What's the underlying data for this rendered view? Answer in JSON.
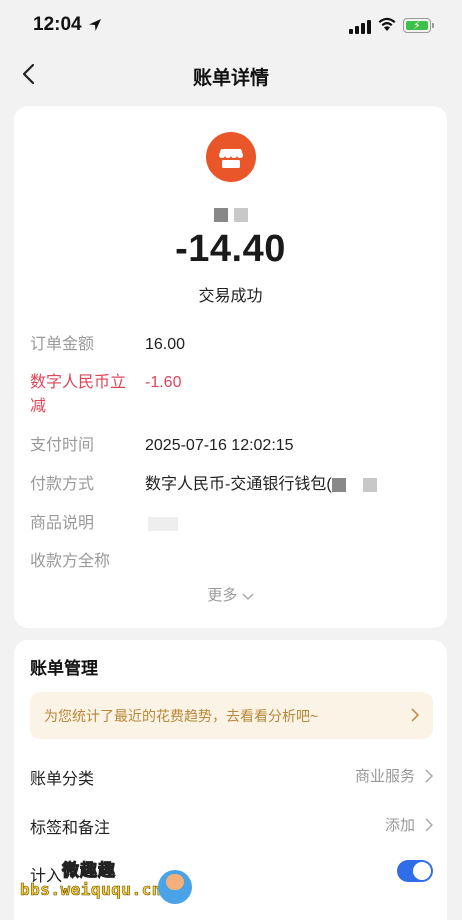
{
  "status_bar": {
    "time": "12:04"
  },
  "nav": {
    "title": "账单详情"
  },
  "transaction": {
    "amount": "-14.40",
    "status": "交易成功",
    "details": [
      {
        "label": "订单金额",
        "value": "16.00"
      },
      {
        "label": "数字人民币立减",
        "value": "-1.60"
      },
      {
        "label": "支付时间",
        "value": "2025-07-16 12:02:15"
      },
      {
        "label": "付款方式",
        "value": "数字人民币-交通银行钱包("
      },
      {
        "label": "商品说明",
        "value": ""
      },
      {
        "label": "收款方全称",
        "value": ""
      }
    ],
    "more_label": "更多"
  },
  "manage": {
    "title": "账单管理",
    "trend_banner": "为您统计了最近的花费趋势，去看看分析吧~",
    "category": {
      "label": "账单分类",
      "value": "商业服务"
    },
    "tags": {
      "label": "标签和备注",
      "value": "添加"
    },
    "count": {
      "label": "计入",
      "enabled": true
    }
  },
  "watermark": {
    "top": "微趣趣",
    "bottom": "bbs.weiququ.cn"
  },
  "colors": {
    "accent": "#2f6de9",
    "merchant_icon": "#e8562a",
    "discount_red": "#e0455a",
    "banner_text": "#b9873a"
  }
}
